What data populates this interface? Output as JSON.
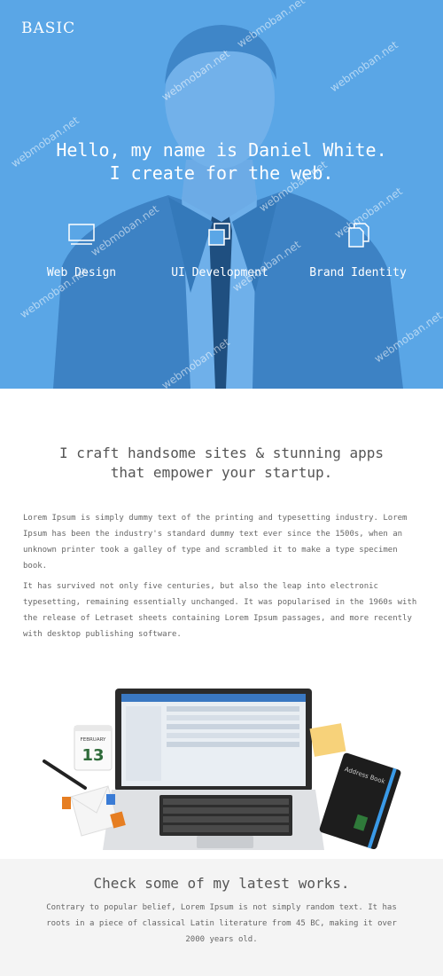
{
  "header": {
    "logo": "BASIC"
  },
  "hero": {
    "greeting": "Hello, my name is ",
    "name": "Daniel White.",
    "tagline": "I create for the web.",
    "services": [
      {
        "label": "Web Design",
        "icon": "monitor-icon"
      },
      {
        "label": "UI Development",
        "icon": "copy-squares-icon"
      },
      {
        "label": "Brand Identity",
        "icon": "documents-icon"
      }
    ],
    "background_color": "#5aa6e6"
  },
  "watermark": "webmoban.net",
  "intro": {
    "heading_line1": "I craft handsome sites & stunning apps",
    "heading_line2": "that empower your startup.",
    "paragraph1": "Lorem Ipsum is simply dummy text of the printing and typesetting industry. Lorem Ipsum has been the industry's standard dummy text ever since the 1500s, when an unknown printer took a galley of type and scrambled it to make a type specimen book.",
    "paragraph2": "It has survived not only five centuries, but also the leap into electronic typesetting, remaining essentially unchanged. It was popularised in the 1960s with the release of Letraset sheets containing Lorem Ipsum passages, and more recently with desktop publishing software."
  },
  "desk": {
    "calendar_month": "FEBRUARY",
    "calendar_day": "13",
    "notebook_label": "Address Book"
  },
  "works": {
    "title": "Check some of my latest works.",
    "text": "Contrary to popular belief, Lorem Ipsum is not simply random text. It has roots in a piece of classical Latin literature from 45 BC, making it over 2000 years old."
  }
}
